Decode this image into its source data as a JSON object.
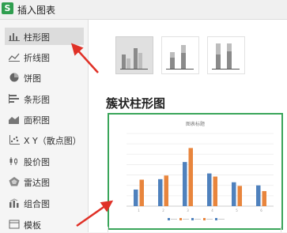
{
  "window": {
    "title": "插入图表",
    "app_icon": "S"
  },
  "sidebar": {
    "items": [
      {
        "label": "柱形图",
        "icon": "column-chart-icon",
        "active": true
      },
      {
        "label": "折线图",
        "icon": "line-chart-icon"
      },
      {
        "label": "饼图",
        "icon": "pie-chart-icon"
      },
      {
        "label": "条形图",
        "icon": "bar-chart-icon"
      },
      {
        "label": "面积图",
        "icon": "area-chart-icon"
      },
      {
        "label": "X Y（散点图）",
        "icon": "scatter-chart-icon"
      },
      {
        "label": "股价图",
        "icon": "stock-chart-icon"
      },
      {
        "label": "雷达图",
        "icon": "radar-chart-icon"
      },
      {
        "label": "组合图",
        "icon": "combo-chart-icon"
      },
      {
        "label": "模板",
        "icon": "template-icon"
      }
    ]
  },
  "main": {
    "subtypes": [
      {
        "name": "clustered-column",
        "active": true
      },
      {
        "name": "stacked-column",
        "active": false
      },
      {
        "name": "percent-stacked-column",
        "active": false
      }
    ],
    "section_title": "簇状柱形图",
    "preview_chart": {
      "title": "图表标题",
      "categories": [
        "1",
        "2",
        "3",
        "4",
        "5",
        "6"
      ],
      "series": [
        {
          "values": [
            3.2,
            5.2,
            8.5,
            6.3,
            4.6,
            4.0
          ],
          "color": "#4f81bd"
        },
        {
          "values": [
            5.1,
            5.9,
            11.2,
            5.7,
            3.9,
            2.9
          ],
          "color": "#e8853d"
        }
      ],
      "ylim": [
        0,
        14
      ]
    }
  },
  "colors": {
    "accent_green": "#3aa55a",
    "annotation_red": "#e03127"
  }
}
